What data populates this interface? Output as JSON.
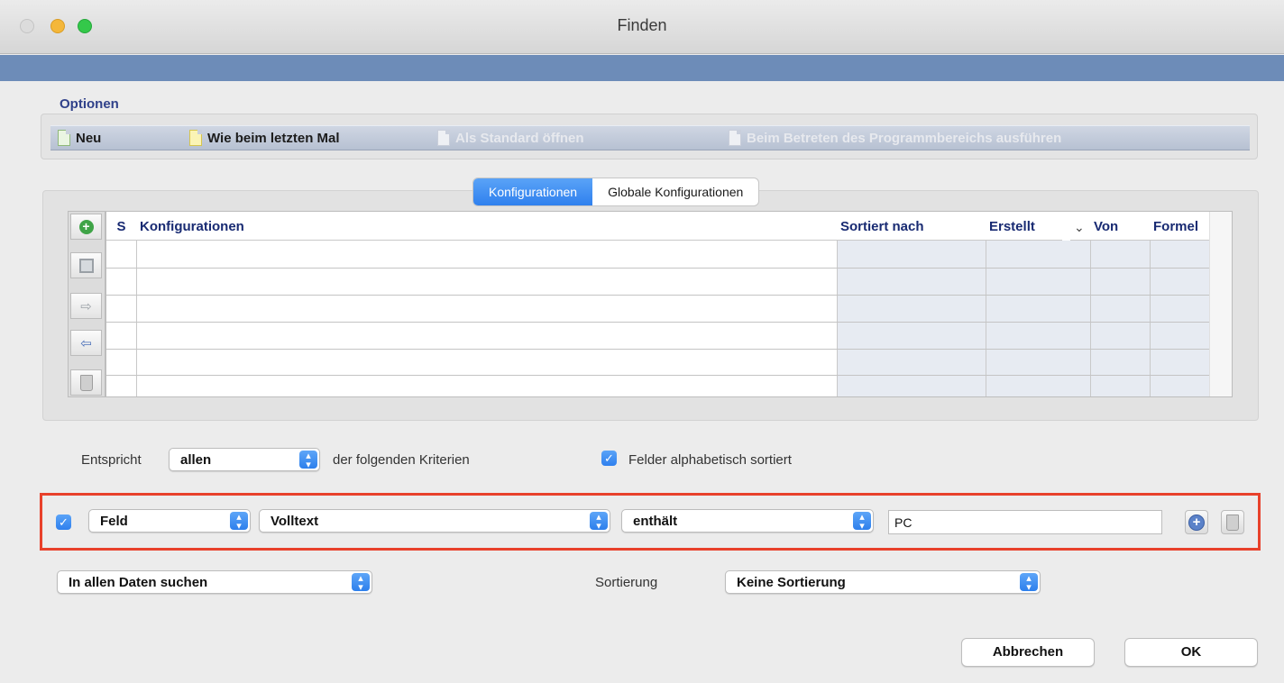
{
  "window": {
    "title": "Finden"
  },
  "options": {
    "heading": "Optionen",
    "items": [
      {
        "label": "Neu",
        "icon": "new-document-icon",
        "enabled": true
      },
      {
        "label": "Wie beim letzten Mal",
        "icon": "document-icon",
        "enabled": true
      },
      {
        "label": "Als Standard öffnen",
        "icon": "document-icon",
        "enabled": false
      },
      {
        "label": "Beim Betreten des Programmbereichs ausführen",
        "icon": "document-icon",
        "enabled": false
      }
    ]
  },
  "tabs": {
    "active": "Konfigurationen",
    "inactive": "Globale Konfigurationen"
  },
  "table": {
    "columns": {
      "s": "S",
      "konfig": "Konfigurationen",
      "sortiert": "Sortiert nach",
      "erstellt": "Erstellt",
      "von": "Von",
      "formel": "Formel"
    },
    "sort_indicator": "⌄",
    "rows": []
  },
  "criteria": {
    "match_label": "Entspricht",
    "match_value": "allen",
    "match_suffix": "der folgenden Kriterien",
    "alpha_sort_label": "Felder alphabetisch sortiert",
    "alpha_sort_checked": true,
    "row": {
      "enabled": true,
      "field_type": "Feld",
      "field": "Volltext",
      "operator": "enthält",
      "value": "PC"
    }
  },
  "scope": {
    "value": "In allen Daten suchen"
  },
  "sort": {
    "label": "Sortierung",
    "value": "Keine Sortierung"
  },
  "buttons": {
    "cancel": "Abbrechen",
    "ok": "OK"
  },
  "colors": {
    "accent": "#2f80ee",
    "title_blue": "#182a72",
    "highlight": "#e8412b",
    "band": "#6d8cb8"
  }
}
